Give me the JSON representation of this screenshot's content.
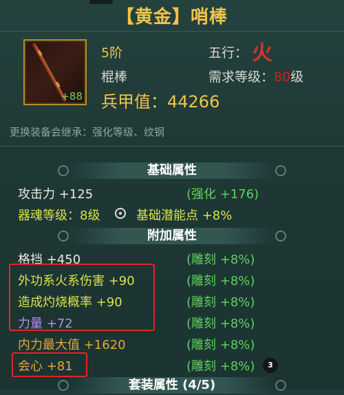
{
  "item": {
    "title": "【黄金】哨棒",
    "icon_bonus": "+88",
    "tier": "5阶",
    "type": "棍棒",
    "wuxing_label": "五行：",
    "wuxing_value": "火",
    "req_label": "需求等级：",
    "req_value": "80",
    "req_suffix": "级",
    "armament": "兵甲值：44266",
    "inherit": "更换装备会继承：强化等级、纹钢"
  },
  "sections": {
    "basic": "基础属性",
    "extra": "附加属性",
    "set": "套装属性 (4/5)"
  },
  "basic": {
    "attack": "攻击力  +125",
    "attack_bonus": "(强化  +176)",
    "soul": "器魂等级：8级",
    "potential": "基础潜能点  +8%"
  },
  "extra": [
    {
      "name": "格挡  +450",
      "bonus": "(雕刻  +8%)",
      "color": "#e9e9e0"
    },
    {
      "name": "外功系火系伤害  +90",
      "bonus": "(雕刻  +8%)",
      "color": "#d9e34a"
    },
    {
      "name": "造成灼烧概率  +90",
      "bonus": "(雕刻  +8%)",
      "color": "#d9e34a"
    },
    {
      "name": "力量  +72",
      "bonus": "(雕刻  +8%)",
      "color": "#b98cf2"
    },
    {
      "name": "内力最大值  +1620",
      "bonus": "(雕刻  +8%)",
      "color": "#e7a73a"
    },
    {
      "name": "会心  +81",
      "bonus": "(雕刻  +8%)",
      "color": "#e7a73a"
    }
  ],
  "badge": "3",
  "colors": {
    "title": "#f3c44a",
    "highlight_box": "#e2252a",
    "fire": "#d43525"
  }
}
